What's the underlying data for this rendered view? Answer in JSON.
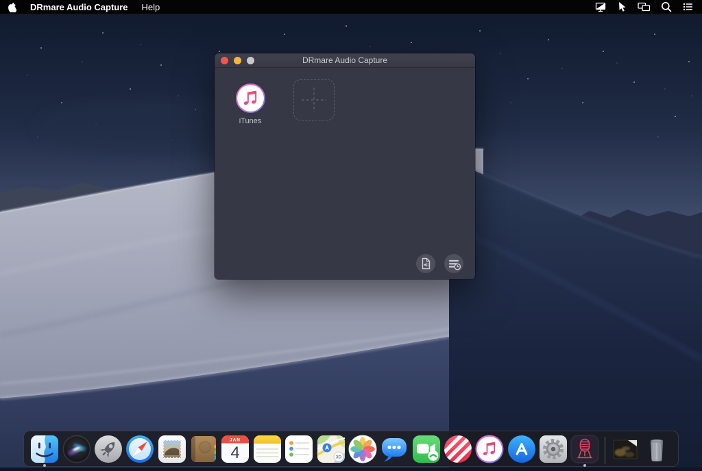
{
  "menu_bar": {
    "app_name": "DRmare Audio Capture",
    "menus": [
      {
        "label": "Help"
      }
    ],
    "status_icons": [
      {
        "name": "display-icon"
      },
      {
        "name": "pointer-icon"
      },
      {
        "name": "screen-mirroring-icon"
      },
      {
        "name": "spotlight-search-icon"
      },
      {
        "name": "notification-center-icon"
      }
    ]
  },
  "window": {
    "title": "DRmare Audio Capture",
    "traffic_lights": {
      "close": "#f4564f",
      "minimize": "#f5b63b",
      "zoom_disabled": "#c9c9cb"
    },
    "sources": [
      {
        "label": "iTunes",
        "icon": "itunes-icon"
      }
    ],
    "add_tile": {
      "icon": "plus-icon"
    },
    "action_buttons": [
      {
        "name": "output-format-button",
        "icon": "audio-file-icon"
      },
      {
        "name": "history-list-button",
        "icon": "history-list-icon"
      }
    ]
  },
  "dock": {
    "items": [
      {
        "label": "Finder",
        "running": true
      },
      {
        "label": "Siri"
      },
      {
        "label": "Launchpad"
      },
      {
        "label": "Safari"
      },
      {
        "label": "Mail"
      },
      {
        "label": "Contacts"
      },
      {
        "label": "Calendar",
        "month": "JAN",
        "day": "4"
      },
      {
        "label": "Notes"
      },
      {
        "label": "Reminders"
      },
      {
        "label": "Maps",
        "badge": "3D"
      },
      {
        "label": "Photos"
      },
      {
        "label": "Messages"
      },
      {
        "label": "FaceTime"
      },
      {
        "label": "News"
      },
      {
        "label": "iTunes"
      },
      {
        "label": "App Store"
      },
      {
        "label": "System Preferences"
      },
      {
        "label": "DRmare Audio Capture",
        "running": true
      },
      {
        "label": "Image File"
      },
      {
        "label": "Trash"
      }
    ]
  },
  "colors": {
    "menubar_bg": "#040404",
    "window_bg": "#363845",
    "titlebar_bg": "#3c3d49",
    "dock_bg": "rgba(27,28,33,0.82)",
    "drmare_red": "#e0475f",
    "wallpaper_sky_top": "#111a2e",
    "wallpaper_dune_light": "#a7abbd",
    "wallpaper_dune_dark": "#1d2740"
  }
}
